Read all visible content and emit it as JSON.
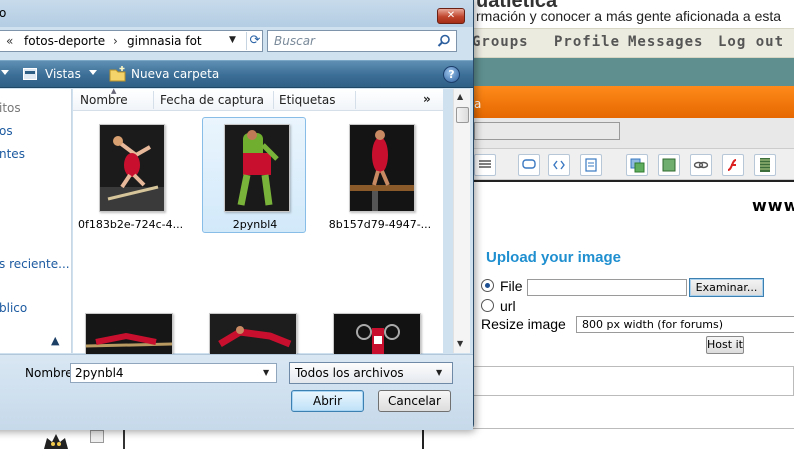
{
  "background_page": {
    "site_title": "uatletica",
    "tagline": "rmación y conocer a más gente aficionada a esta",
    "nav": [
      "Groups",
      "Profile",
      "Messages",
      "Log out"
    ],
    "orange_bar_text": "a",
    "watermark": "www",
    "upload": {
      "title": "Upload your image",
      "file_label": "File",
      "url_label": "url",
      "browse_button": "Examinar...",
      "resize_label": "Resize image",
      "resize_value": "800 px width (for forums)",
      "host_button": "Host it",
      "selected_source": "File"
    }
  },
  "dialog": {
    "title": "o",
    "close_glyph": "✕",
    "address": {
      "prefix": "«",
      "crumbs": [
        "fotos-deporte",
        "gimnasia fot"
      ],
      "separator": "›"
    },
    "search_placeholder": "Buscar",
    "commandbar": {
      "views_label": "Vistas",
      "new_folder_label": "Nueva carpeta",
      "help": "?"
    },
    "nav_items": [
      "itos",
      "os",
      "ntes",
      "s reciente...",
      "blico"
    ],
    "columns": [
      "Nombre",
      "Fecha de captura",
      "Etiquetas"
    ],
    "more_columns": "»",
    "files": [
      {
        "name": "0f183b2e-724c-4...",
        "selected": false
      },
      {
        "name": "2pynbl4",
        "selected": true
      },
      {
        "name": "8b157d79-4947-...",
        "selected": false
      }
    ],
    "filename_label": "Nombre:",
    "filename_value": "2pynbl4",
    "filetype": "Todos los archivos",
    "open_button": "Abrir",
    "cancel_button": "Cancelar"
  },
  "colors": {
    "accent_blue": "#1f8fd0",
    "orange_bar": "#f07a10",
    "selection": "#d2e9fa"
  }
}
